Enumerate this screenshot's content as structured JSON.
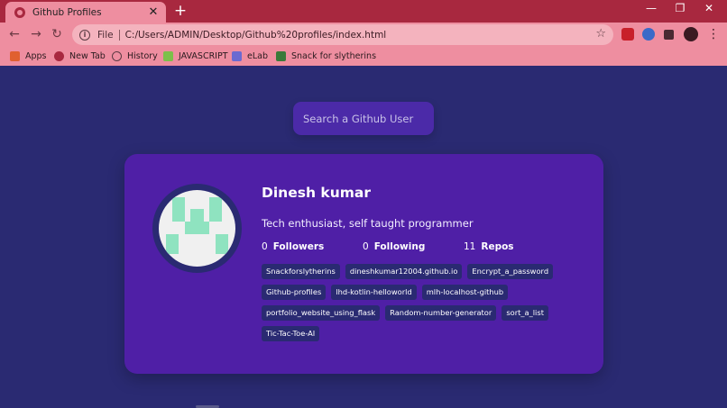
{
  "browser": {
    "tab_title": "Github Profiles",
    "tab_close": "✕",
    "new_tab": "+",
    "win_minimize": "—",
    "win_maximize": "❐",
    "win_close": "✕",
    "back": "←",
    "forward": "→",
    "reload": "↻",
    "omnibox_scheme": "File",
    "omnibox_url": "C:/Users/ADMIN/Desktop/Github%20profiles/index.html",
    "star": "☆",
    "menu": "⋮",
    "bookmarks": [
      {
        "label": "Apps",
        "icon": "apps-grid-icon",
        "color": "#e06030"
      },
      {
        "label": "New Tab",
        "icon": "new-tab-icon",
        "color": "#a8283f"
      },
      {
        "label": "History",
        "icon": "history-icon",
        "color": "#5a3a42"
      },
      {
        "label": "JAVASCRIPT",
        "icon": "javascript-icon",
        "color": "#7cc04a"
      },
      {
        "label": "eLab",
        "icon": "elab-icon",
        "color": "#6a6ad0"
      },
      {
        "label": "Snack for slytherins",
        "icon": "snake-icon",
        "color": "#3a7a3a"
      }
    ]
  },
  "search": {
    "placeholder": "Search a Github User"
  },
  "profile": {
    "name": "Dinesh kumar",
    "bio": "Tech enthusiast, self taught programmer",
    "followers": "0",
    "followers_label": "Followers",
    "following": "0",
    "following_label": "Following",
    "repos": "11",
    "repos_label": "Repos",
    "repo_list": [
      "Snackforslytherins",
      "dineshkumar12004.github.io",
      "Encrypt_a_password",
      "Github-profiles",
      "lhd-kotlin-helloworld",
      "mlh-localhost-github",
      "portfolio_website_using_flask",
      "Random-number-generator",
      "sort_a_list",
      "Tic-Tac-Toe-AI"
    ]
  },
  "colors": {
    "page_bg": "#2a2a72",
    "card_bg": "#4f1fa6",
    "tag_bg": "#2a2a72",
    "identicon": "#8fe3c0",
    "chrome_tabstrip": "#a8283f",
    "chrome_toolbar": "#ee8ea0"
  }
}
